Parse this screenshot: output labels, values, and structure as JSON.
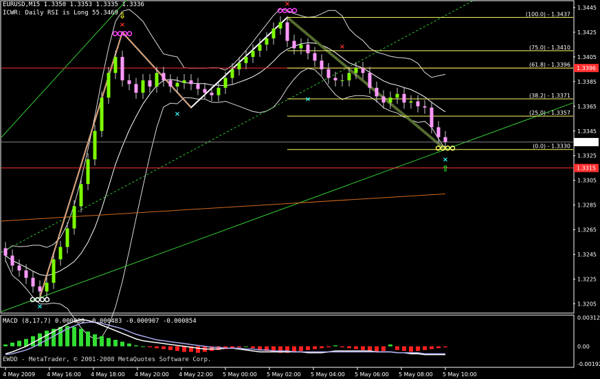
{
  "header": {
    "symbol_line": "EURUSD,M15  1.3350 1.3353 1.3335 1.3336",
    "indicator_line": "ICWR: Daily RSI is Long 55.3469"
  },
  "macd_header": "MACD (8,17,7) 0.000000 -0.000483 -0.000907 -0.000854",
  "copyright": "EWDD - MetaTrader, © 2001-2008 MetaQuotes Software Corp.",
  "colors": {
    "background": "#000000",
    "grid_frame": "#ffffff",
    "bull_candle": "#7cfc00",
    "bear_candle": "#ff99ff",
    "fib": "#ffff66",
    "red_level": "#ff3030",
    "channel": "#33cc33",
    "orange": "#d2691e",
    "macd_pos": "#33dd33",
    "macd_neg": "#ff2020"
  },
  "chart_data": [
    {
      "type": "candlestick",
      "title": "EURUSD,M15",
      "ylim": [
        1.3198,
        1.345
      ],
      "y_ticks": [
        "1.3445",
        "1.3425",
        "1.3405",
        "1.3385",
        "1.3365",
        "1.3345",
        "1.3325",
        "1.3305",
        "1.3285",
        "1.3265",
        "1.3245",
        "1.3225",
        "1.3205"
      ],
      "x_ticks": [
        "4 May 2009",
        "4 May 16:00",
        "4 May 18:00",
        "4 May 20:00",
        "4 May 22:00",
        "5 May 00:00",
        "5 May 02:00",
        "5 May 04:00",
        "5 May 06:00",
        "5 May 08:00",
        "5 May 10:00"
      ],
      "close_series": [
        1.3244,
        1.3236,
        1.3232,
        1.3226,
        1.3219,
        1.3215,
        1.3222,
        1.3241,
        1.3251,
        1.3266,
        1.3284,
        1.3302,
        1.3322,
        1.3345,
        1.3372,
        1.3392,
        1.3405,
        1.3386,
        1.3383,
        1.3376,
        1.3386,
        1.3381,
        1.3392,
        1.3386,
        1.3381,
        1.3384,
        1.3386,
        1.3383,
        1.3379,
        1.3376,
        1.3374,
        1.338,
        1.3388,
        1.3395,
        1.34,
        1.3405,
        1.341,
        1.3415,
        1.342,
        1.3428,
        1.3433,
        1.3418,
        1.3412,
        1.3415,
        1.3408,
        1.3402,
        1.3395,
        1.3388,
        1.3386,
        1.3386,
        1.3392,
        1.3396,
        1.3392,
        1.338,
        1.3373,
        1.3368,
        1.3372,
        1.3375,
        1.3368,
        1.3369,
        1.3365,
        1.3364,
        1.3348,
        1.334,
        1.3336
      ],
      "fib_levels": [
        {
          "label": "(100.0) - 1.3437",
          "price": 1.3437
        },
        {
          "label": "(75.0) - 1.3410",
          "price": 1.341
        },
        {
          "label": "(61.8) - 1.3396",
          "price": 1.3396
        },
        {
          "label": "(38.2) - 1.3371",
          "price": 1.3371
        },
        {
          "label": "(25.0) - 1.3357",
          "price": 1.3357
        },
        {
          "label": "(0.0) - 1.3330",
          "price": 1.333
        }
      ],
      "price_boxes": [
        {
          "label": "1.3396",
          "price": 1.3396,
          "color": "#ff3030"
        },
        {
          "label": "1.3336",
          "price": 1.3336,
          "color": "#ffffff"
        },
        {
          "label": "1.3315",
          "price": 1.3315,
          "color": "#ff3030"
        }
      ],
      "red_levels": [
        1.3396,
        1.3315
      ],
      "current_price": 1.3336,
      "swing_points": [
        {
          "name": "low-1",
          "bar": 5,
          "price": 1.321
        },
        {
          "name": "high-1",
          "bar": 17,
          "price": 1.3425
        },
        {
          "name": "low-2",
          "bar": 27,
          "price": 1.3364
        },
        {
          "name": "high-2",
          "bar": 41,
          "price": 1.3437
        },
        {
          "name": "low-3",
          "bar": 64,
          "price": 1.333
        }
      ]
    },
    {
      "type": "bar",
      "title": "MACD (8,17,7)",
      "ylim": [
        -0.0022,
        0.0033
      ],
      "y_ticks": [
        "0.003120",
        "0.00",
        "-0.00192"
      ],
      "histogram": [
        0.0002,
        0.0004,
        0.0006,
        0.0008,
        0.0011,
        0.0014,
        0.0017,
        0.0019,
        0.0021,
        0.0022,
        0.0021,
        0.0019,
        0.0016,
        0.0013,
        0.0011,
        0.0009,
        0.0007,
        0.0005,
        0.0003,
        0.0001,
        0.0,
        -0.0001,
        -0.0002,
        -0.0003,
        -0.0004,
        -0.0005,
        -0.0006,
        -0.0006,
        -0.0007,
        -0.0006,
        -0.0005,
        -0.0004,
        -0.0003,
        -0.0002,
        -0.0001,
        0.0,
        -0.0002,
        -0.0004,
        -0.0005,
        -0.0006,
        -0.0007,
        -0.0007,
        -0.0006,
        -0.0005,
        -0.0004,
        -0.0003,
        -0.0002,
        -0.0001,
        0.0001,
        -0.0001,
        -0.0002,
        -0.0003,
        -0.0004,
        -0.0005,
        -0.0006,
        -0.0005,
        0.0002,
        -0.0004,
        -0.0005,
        -0.0006,
        -0.0005,
        -0.0004,
        -0.0003,
        -0.0002,
        -0.0001
      ],
      "macd_line": [
        -0.0008,
        -0.0006,
        -0.0003,
        0.0,
        0.0004,
        0.0008,
        0.0012,
        0.0016,
        0.002,
        0.0024,
        0.0027,
        0.0029,
        0.0028,
        0.0026,
        0.0023,
        0.002,
        0.0017,
        0.0014,
        0.0011,
        0.0008,
        0.0006,
        0.0005,
        0.0004,
        0.0003,
        0.0002,
        0.0001,
        0.0,
        -0.0001,
        -0.0002,
        -0.0003,
        -0.0003,
        -0.0003,
        -0.0002,
        -0.0002,
        -0.0003,
        -0.0004,
        -0.0005,
        -0.0006,
        -0.0006,
        -0.0006,
        -0.0006,
        -0.0006,
        -0.0006,
        -0.0006,
        -0.0007,
        -0.0007,
        -0.0007,
        -0.0006,
        -0.0005,
        -0.0005,
        -0.0005,
        -0.0005,
        -0.0005,
        -0.0005,
        -0.0006,
        -0.0006,
        -0.0006,
        -0.0007,
        -0.0007,
        -0.0008,
        -0.0008,
        -0.0009,
        -0.0009,
        -0.0009,
        -0.0009
      ],
      "signal_line": [
        -0.0009,
        -0.0008,
        -0.0006,
        -0.0004,
        -0.0001,
        0.0003,
        0.0007,
        0.0011,
        0.0015,
        0.0019,
        0.0022,
        0.0025,
        0.0026,
        0.0026,
        0.0025,
        0.0023,
        0.0021,
        0.0019,
        0.0016,
        0.0013,
        0.0011,
        0.0009,
        0.0007,
        0.0006,
        0.0005,
        0.0004,
        0.0003,
        0.0002,
        0.0001,
        0.0,
        -0.0001,
        -0.0001,
        -0.0002,
        -0.0002,
        -0.0002,
        -0.0003,
        -0.0003,
        -0.0004,
        -0.0004,
        -0.0005,
        -0.0005,
        -0.0005,
        -0.0006,
        -0.0006,
        -0.0006,
        -0.0006,
        -0.0006,
        -0.0006,
        -0.0006,
        -0.0006,
        -0.0006,
        -0.0006,
        -0.0006,
        -0.0006,
        -0.0006,
        -0.0006,
        -0.0006,
        -0.0007,
        -0.0007,
        -0.0007,
        -0.0007,
        -0.0008,
        -0.0008,
        -0.0008,
        -0.0008
      ]
    }
  ]
}
